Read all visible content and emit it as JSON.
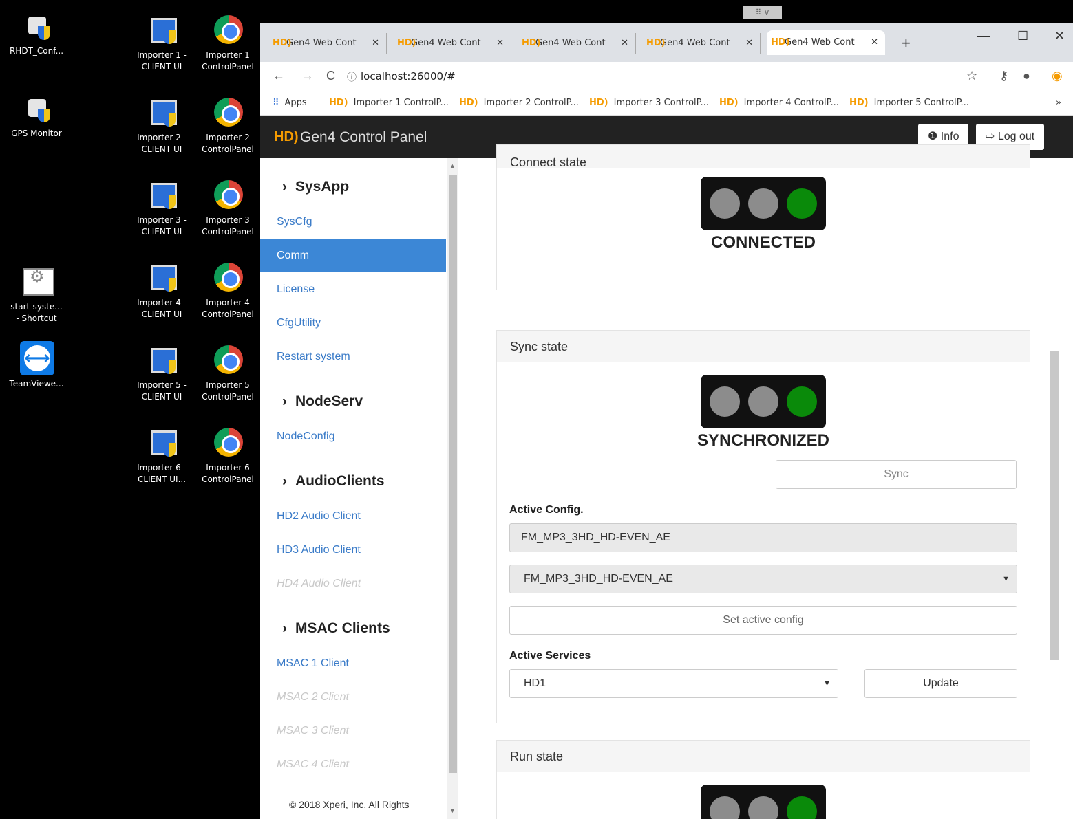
{
  "desktop": {
    "icons": [
      {
        "label": "RHDT_Conf...",
        "kind": "sat"
      },
      {
        "label": "GPS Monitor",
        "kind": "sat"
      },
      {
        "label": "start-syste...\n- Shortcut",
        "kind": "gear"
      },
      {
        "label": "TeamViewe...",
        "kind": "tv"
      },
      {
        "label": "Importer 1 -\nCLIENT UI",
        "kind": "app"
      },
      {
        "label": "Importer 1\nControlPanel",
        "kind": "chrome"
      },
      {
        "label": "Importer 2 -\nCLIENT UI",
        "kind": "app"
      },
      {
        "label": "Importer 2\nControlPanel",
        "kind": "chrome"
      },
      {
        "label": "Importer 3 -\nCLIENT UI",
        "kind": "app"
      },
      {
        "label": "Importer 3\nControlPanel",
        "kind": "chrome"
      },
      {
        "label": "Importer 4 -\nCLIENT UI",
        "kind": "app"
      },
      {
        "label": "Importer 4\nControlPanel",
        "kind": "chrome"
      },
      {
        "label": "Importer 5 -\nCLIENT UI",
        "kind": "app"
      },
      {
        "label": "Importer 5\nControlPanel",
        "kind": "chrome"
      },
      {
        "label": "Importer 6 -\nCLIENT UI...",
        "kind": "app"
      },
      {
        "label": "Importer 6\nControlPanel",
        "kind": "chrome"
      }
    ]
  },
  "browser": {
    "tabs": [
      {
        "label": "Gen4 Web Cont"
      },
      {
        "label": "Gen4 Web Cont"
      },
      {
        "label": "Gen4 Web Cont"
      },
      {
        "label": "Gen4 Web Cont"
      },
      {
        "label": "Gen4 Web Cont"
      }
    ],
    "favicon": "HD)",
    "url": "localhost:26000/#",
    "bookmarks": {
      "apps": "Apps",
      "items": [
        "Importer 1 ControlP...",
        "Importer 2 ControlP...",
        "Importer 3 ControlP...",
        "Importer 4 ControlP...",
        "Importer 5 ControlP..."
      ],
      "more": "»"
    }
  },
  "app": {
    "logo": "HD)",
    "title": "Gen4 Control Panel",
    "info_label": "Info",
    "logout_label": "Log out"
  },
  "sidebar": {
    "sections": [
      {
        "title": "SysApp"
      },
      {
        "title": "NodeServ"
      },
      {
        "title": "AudioClients"
      },
      {
        "title": "MSAC Clients"
      }
    ],
    "items": [
      {
        "label": "SysCfg"
      },
      {
        "label": "Comm"
      },
      {
        "label": "License"
      },
      {
        "label": "CfgUtility"
      },
      {
        "label": "Restart system"
      },
      {
        "label": "NodeConfig"
      },
      {
        "label": "HD2 Audio Client"
      },
      {
        "label": "HD3 Audio Client"
      },
      {
        "label": "HD4 Audio Client"
      },
      {
        "label": "MSAC 1 Client"
      },
      {
        "label": "MSAC 2 Client"
      },
      {
        "label": "MSAC 3 Client"
      },
      {
        "label": "MSAC 4 Client"
      }
    ],
    "copyright": "© 2018 Xperi, Inc. All Rights"
  },
  "main": {
    "connect": {
      "title": "Connect state",
      "status": "CONNECTED"
    },
    "sync": {
      "title": "Sync state",
      "status": "SYNCHRONIZED",
      "sync_button": "Sync",
      "active_config_label": "Active Config.",
      "active_config_value": "FM_MP3_3HD_HD-EVEN_AE",
      "config_select_value": "FM_MP3_3HD_HD-EVEN_AE",
      "set_button": "Set active config",
      "services_label": "Active Services",
      "services_value": "HD1",
      "update_button": "Update"
    },
    "run": {
      "title": "Run state"
    }
  },
  "colors": {
    "accent": "#3c87d6",
    "green": "#0a8a0a",
    "brand": "#f59b00"
  }
}
